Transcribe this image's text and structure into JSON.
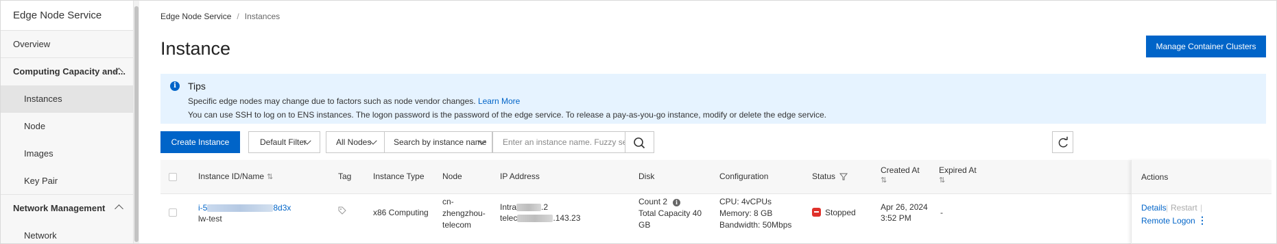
{
  "sidebar": {
    "title": "Edge Node Service",
    "items": [
      {
        "label": "Overview"
      },
      {
        "label": "Computing Capacity and..."
      },
      {
        "label": "Instances"
      },
      {
        "label": "Node"
      },
      {
        "label": "Images"
      },
      {
        "label": "Key Pair"
      },
      {
        "label": "Network Management"
      },
      {
        "label": "Network"
      }
    ]
  },
  "breadcrumb": {
    "root": "Edge Node Service",
    "separator": "/",
    "current": "Instances"
  },
  "page": {
    "title": "Instance",
    "manage_button": "Manage Container Clusters"
  },
  "tips": {
    "title": "Tips",
    "line1": "Specific edge nodes may change due to factors such as node vendor changes.",
    "learn_more": "Learn More",
    "line2": "You can use SSH to log on to ENS instances. The logon password is the password of the edge service. To release a pay-as-you-go instance, modify or delete the edge service."
  },
  "toolbar": {
    "create_button": "Create Instance",
    "filter_select": "Default Filter",
    "nodes_select": "All Nodes",
    "search_by_select": "Search by instance name",
    "search_placeholder": "Enter an instance name. Fuzzy search"
  },
  "table": {
    "headers": {
      "id_name": "Instance ID/Name",
      "tag": "Tag",
      "type": "Instance Type",
      "node": "Node",
      "ip": "IP Address",
      "disk": "Disk",
      "config": "Configuration",
      "status": "Status",
      "created": "Created At",
      "expired": "Expired At",
      "actions": "Actions"
    },
    "rows": [
      {
        "id_prefix": "i-5",
        "id_suffix": "8d3x",
        "name": "lw-test",
        "type": "x86 Computing",
        "node_l1": "cn-",
        "node_l2": "zhengzhou-",
        "node_l3": "telecom",
        "ip_l1_prefix": "Intra",
        "ip_l1_suffix": ".2",
        "ip_l2_prefix": "telec",
        "ip_l2_suffix": ".143.23",
        "disk_count": "Count  2",
        "disk_total_l1": "Total Capacity  40",
        "disk_total_l2": "GB",
        "cpu": "CPU: 4vCPUs",
        "memory": "Memory: 8 GB",
        "bandwidth": "Bandwidth: 50Mbps",
        "status": "Stopped",
        "created_l1": "Apr 26, 2024",
        "created_l2": "3:52 PM",
        "expired": "-",
        "action_details": "Details",
        "action_restart": "Restart",
        "action_remote": "Remote Logon"
      }
    ]
  },
  "colors": {
    "primary": "#0064c8",
    "stopped": "#e0312b",
    "tips_bg": "#e6f3ff"
  }
}
